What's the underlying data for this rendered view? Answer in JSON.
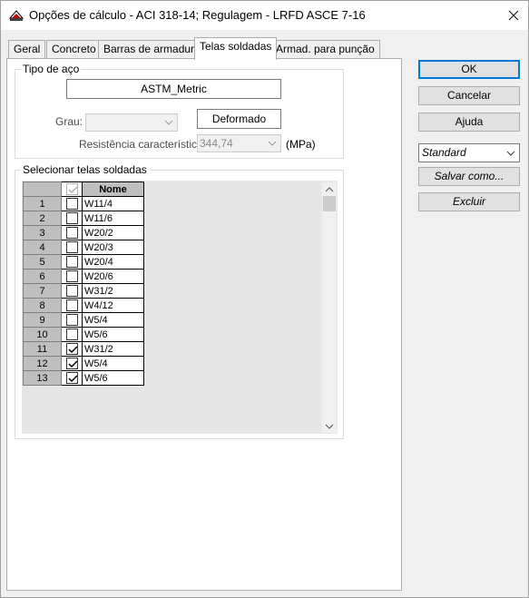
{
  "window": {
    "title": "Opções de cálculo - ACI 318-14;  Regulagem - LRFD ASCE 7-16"
  },
  "tabs": [
    {
      "label": "Geral"
    },
    {
      "label": "Concreto"
    },
    {
      "label": "Barras de armadura"
    },
    {
      "label": "Telas soldadas"
    },
    {
      "label": "Armad. para punção"
    }
  ],
  "active_tab": "Telas soldadas",
  "steel_group": {
    "title": "Tipo de aço",
    "steel_type": "ASTM_Metric",
    "grade_label": "Grau:",
    "grade_value": "",
    "deformed_button": "Deformado",
    "strength_label": "Resistência característica",
    "strength_value": "344,74",
    "strength_unit": "(MPa)"
  },
  "mesh_group": {
    "title": "Selecionar telas soldadas",
    "header_name": "Nome",
    "rows": [
      {
        "num": "1",
        "name": "W11/4",
        "checked": false
      },
      {
        "num": "2",
        "name": "W11/6",
        "checked": false
      },
      {
        "num": "3",
        "name": "W20/2",
        "checked": false
      },
      {
        "num": "4",
        "name": "W20/3",
        "checked": false
      },
      {
        "num": "5",
        "name": "W20/4",
        "checked": false
      },
      {
        "num": "6",
        "name": "W20/6",
        "checked": false
      },
      {
        "num": "7",
        "name": "W31/2",
        "checked": false
      },
      {
        "num": "8",
        "name": "W4/12",
        "checked": false
      },
      {
        "num": "9",
        "name": "W5/4",
        "checked": false
      },
      {
        "num": "10",
        "name": "W5/6",
        "checked": false
      },
      {
        "num": "11",
        "name": "W31/2",
        "checked": true
      },
      {
        "num": "12",
        "name": "W5/4",
        "checked": true
      },
      {
        "num": "13",
        "name": "W5/6",
        "checked": true
      }
    ]
  },
  "buttons": {
    "ok": "OK",
    "cancel": "Cancelar",
    "help": "Ajuda",
    "preset": "Standard",
    "save_as": "Salvar como...",
    "delete": "Excluir"
  },
  "colors": {
    "accent": "#0078d7",
    "row_header": "#bfbfbf",
    "grid_bg": "#e6e6e6"
  }
}
